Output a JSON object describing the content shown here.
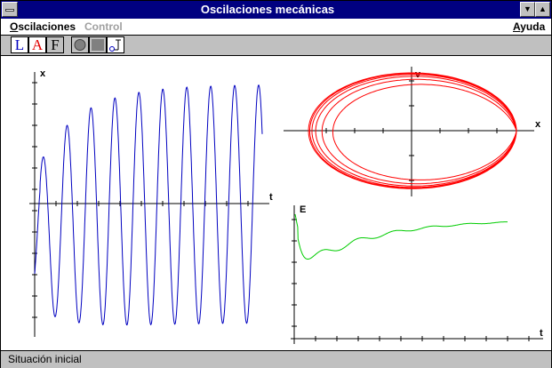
{
  "window": {
    "title": "Oscilaciones mecánicas"
  },
  "menubar": {
    "items": [
      {
        "label": "Oscilaciones",
        "underline": "O",
        "enabled": true
      },
      {
        "label": "Control",
        "underline": "",
        "enabled": false
      },
      {
        "label": "Ayuda",
        "underline": "A",
        "enabled": true
      }
    ]
  },
  "toolbar": {
    "buttons": [
      {
        "label": "L",
        "color": "#0000c0"
      },
      {
        "label": "A",
        "color": "#e00000"
      },
      {
        "label": "F",
        "color": "#000000"
      }
    ],
    "icons": [
      "record-icon",
      "stop-icon",
      "pendulum-icon"
    ]
  },
  "status": {
    "text": "Situación inicial"
  },
  "chart_data": [
    {
      "type": "line",
      "name": "displacement-vs-time",
      "ylabel": "x",
      "xlabel": "t",
      "color": "#0000c0",
      "amplitude_envelope": {
        "start": 0.0,
        "end": 1.0
      },
      "oscillations": 10
    },
    {
      "type": "line",
      "name": "phase-portrait",
      "xlabel": "x",
      "ylabel": "v",
      "color": "#ff0000",
      "cycles": 6
    },
    {
      "type": "line",
      "name": "energy-vs-time",
      "xlabel": "t",
      "ylabel": "E",
      "color": "#00cc00",
      "initial": 1.0,
      "minimum": 0.27,
      "final": 0.88
    }
  ]
}
